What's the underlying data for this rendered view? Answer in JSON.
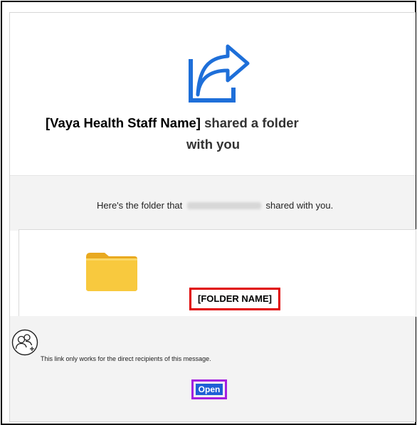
{
  "header": {
    "sender_name": "[Vaya Health Staff Name]",
    "title_rest": "shared a folder",
    "title_line2": "with you"
  },
  "message": {
    "prefix": "Here's the folder that",
    "suffix": "shared with you."
  },
  "folder": {
    "name": "[FOLDER NAME]"
  },
  "footer": {
    "notice": "This link only works for the direct recipients of this message.",
    "open_label": "Open"
  },
  "icons": {
    "share": "share-arrow-icon",
    "folder": "folder-icon",
    "people": "people-add-icon"
  },
  "colors": {
    "accent_blue": "#1e6fd9",
    "open_button": "#1e5fd6",
    "folder_yellow": "#f8c93e",
    "highlight_red": "#e00000",
    "highlight_purple": "#a31fe0",
    "band_gray": "#f3f3f3"
  }
}
